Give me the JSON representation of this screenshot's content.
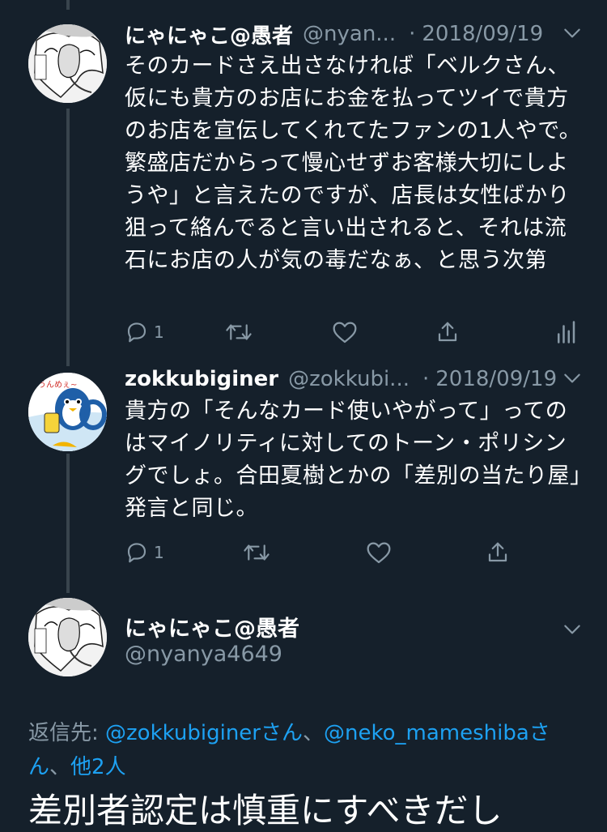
{
  "tweets": [
    {
      "display_name": "にゃにゃこ@愚者",
      "handle": "@nyan...",
      "separator": "·",
      "date": "2018/09/19",
      "text": "そのカードさえ出さなければ「ベルクさん、仮にも貴方のお店にお金を払ってツイで貴方のお店を宣伝してくれてたファンの1人やで。繁盛店だからって慢心せずお客様大切にしようや」と言えたのですが、店長は女性ばかり狙って絡んでると言い出されると、それは流石にお店の人が気の毒だなぁ、と思う次第",
      "reply_count": "1"
    },
    {
      "display_name": "zokkubiginer",
      "handle": "@zokkubi...",
      "separator": "·",
      "date": "2018/09/19",
      "text": "貴方の「そんなカード使いやがって」ってのはマイノリティに対してのトーン・ポリシングでしょ。合田夏樹とかの「差別の当たり屋」発言と同じ。",
      "reply_count": "1",
      "avatar_text": "うんめぇ~"
    }
  ],
  "main_tweet": {
    "display_name": "にゃにゃこ@愚者",
    "handle": "@nyanya4649",
    "reply_prefix": "返信先: ",
    "mention_1": "@zokkubiginerさん",
    "separator_1": "、",
    "mention_2": "@neko_mameshibaさん",
    "separator_2": "、",
    "others": "他2人",
    "text": "差別者認定は慎重にすべきだし"
  },
  "colors": {
    "background": "#15202b",
    "secondary_text": "#8899a6",
    "link": "#1da1f2",
    "thread_line": "#38444d"
  },
  "icons": [
    "reply-icon",
    "retweet-icon",
    "like-icon",
    "share-icon",
    "analytics-icon",
    "chevron-down-icon"
  ]
}
